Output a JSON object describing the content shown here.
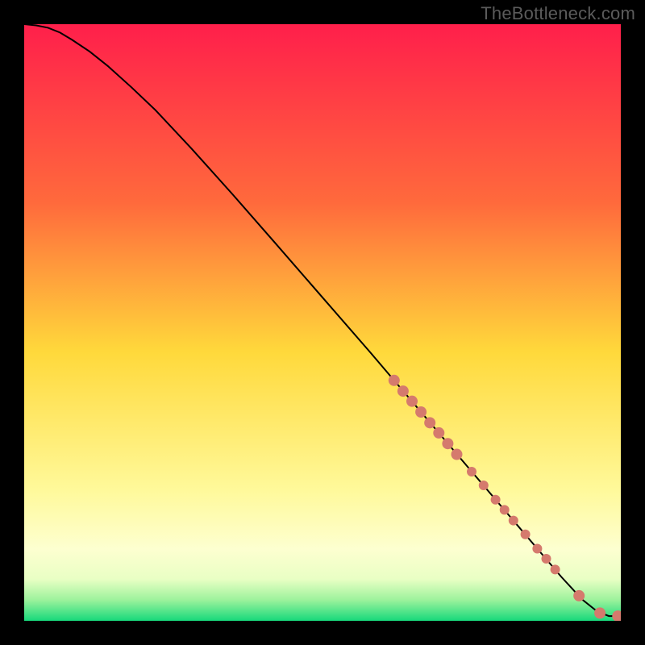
{
  "watermark": "TheBottleneck.com",
  "chart_data": {
    "type": "line",
    "title": "",
    "xlabel": "",
    "ylabel": "",
    "xlim": [
      0,
      100
    ],
    "ylim": [
      0,
      100
    ],
    "background_gradient": {
      "stops": [
        {
          "offset": 0.0,
          "color": "#ff1f4b"
        },
        {
          "offset": 0.3,
          "color": "#ff6a3c"
        },
        {
          "offset": 0.55,
          "color": "#ffd93b"
        },
        {
          "offset": 0.78,
          "color": "#fff99a"
        },
        {
          "offset": 0.88,
          "color": "#fdffd0"
        },
        {
          "offset": 0.93,
          "color": "#e9ffc4"
        },
        {
          "offset": 0.965,
          "color": "#9cf29c"
        },
        {
          "offset": 1.0,
          "color": "#17d97b"
        }
      ]
    },
    "series": [
      {
        "name": "curve",
        "type": "line",
        "color": "#000000",
        "x": [
          0,
          2,
          4,
          6,
          8,
          11,
          14,
          18,
          22,
          28,
          35,
          42,
          50,
          58,
          66,
          74,
          82,
          90,
          93.5,
          96,
          98,
          100
        ],
        "y": [
          100,
          99.8,
          99.4,
          98.6,
          97.4,
          95.4,
          93.0,
          89.4,
          85.6,
          79.2,
          71.4,
          63.4,
          54.2,
          45.0,
          35.6,
          26.2,
          16.8,
          7.4,
          3.6,
          1.6,
          0.8,
          0.8
        ]
      },
      {
        "name": "markers",
        "type": "scatter",
        "color": "#d57a6d",
        "x": [
          62,
          63.5,
          65,
          66.5,
          68,
          69.5,
          71,
          72.5,
          75,
          77,
          79,
          80.5,
          82,
          84,
          86,
          87.5,
          89,
          93,
          96.5,
          99.5
        ],
        "y": [
          40.3,
          38.5,
          36.8,
          35.0,
          33.2,
          31.5,
          29.7,
          27.9,
          25.0,
          22.7,
          20.3,
          18.6,
          16.8,
          14.5,
          12.1,
          10.4,
          8.6,
          4.2,
          1.3,
          0.8
        ],
        "r": [
          7,
          7,
          7,
          7,
          7,
          7,
          7,
          7,
          6,
          6,
          6,
          6,
          6,
          6,
          6,
          6,
          6,
          7,
          7,
          7
        ]
      }
    ]
  }
}
